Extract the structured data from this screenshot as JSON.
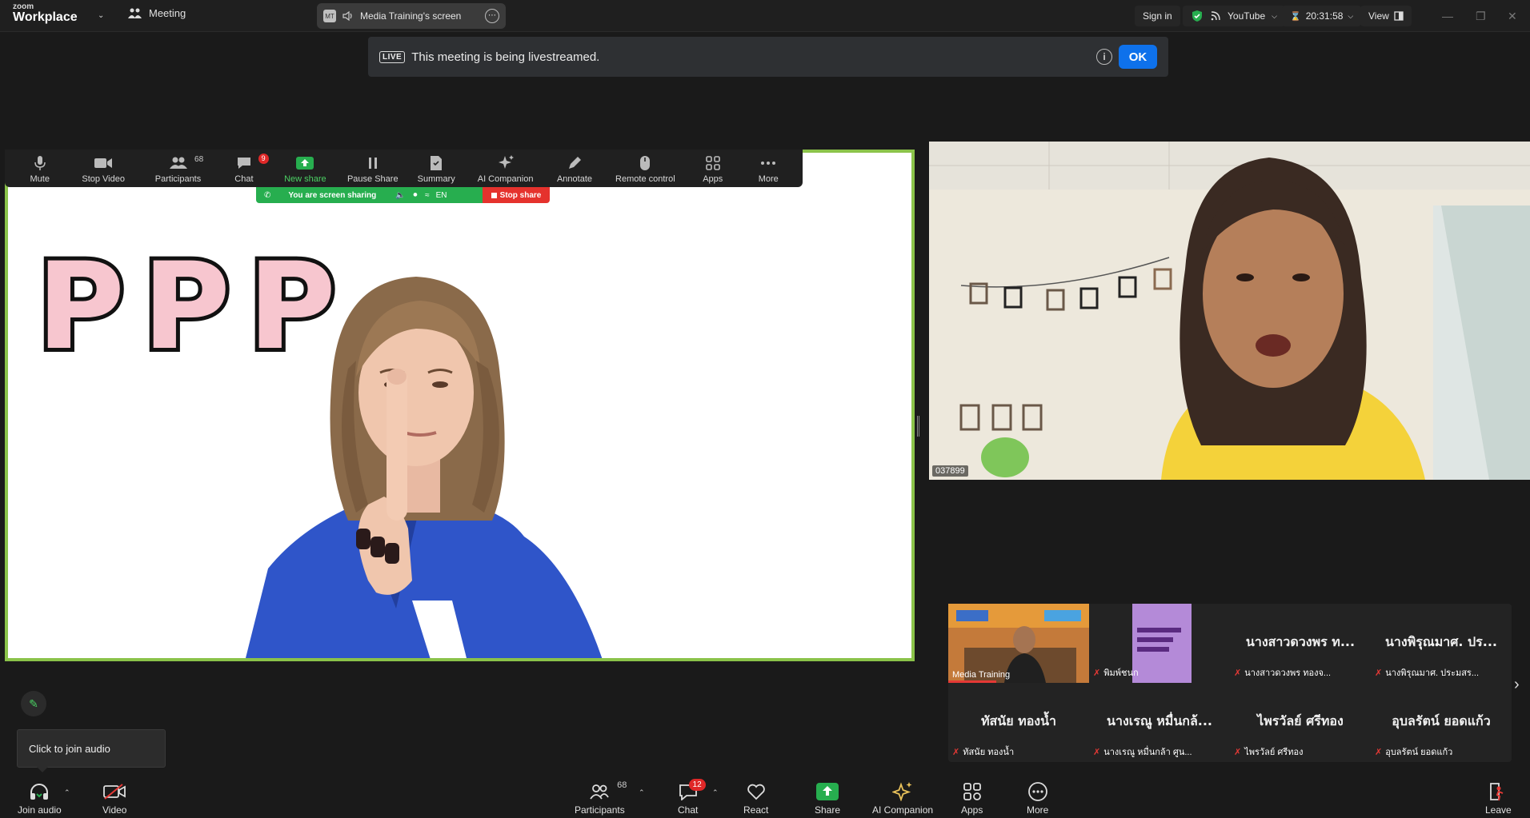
{
  "topbar": {
    "logo_small": "zoom",
    "logo_big": "Workplace",
    "meeting_label": "Meeting",
    "share_tab_label": "Media Training's screen",
    "share_tab_avatar": "MT",
    "sign_in": "Sign in",
    "youtube": "YouTube",
    "timer": "20:31:58",
    "view": "View"
  },
  "banner": {
    "badge": "LIVE",
    "text": "This meeting is being livestreamed.",
    "ok": "OK"
  },
  "share_toolbar": {
    "items": [
      {
        "label": "Mute",
        "icon": "mic-icon"
      },
      {
        "label": "Stop Video",
        "icon": "video-icon"
      },
      {
        "label": "Participants",
        "icon": "participants-icon",
        "count": "68"
      },
      {
        "label": "Chat",
        "icon": "chat-icon",
        "badge": "9"
      },
      {
        "label": "New share",
        "icon": "share-icon"
      },
      {
        "label": "Pause Share",
        "icon": "pause-icon"
      },
      {
        "label": "Summary",
        "icon": "summary-icon"
      },
      {
        "label": "AI Companion",
        "icon": "sparkle-icon"
      },
      {
        "label": "Annotate",
        "icon": "pen-icon"
      },
      {
        "label": "Remote control",
        "icon": "mouse-icon"
      },
      {
        "label": "Apps",
        "icon": "apps-icon"
      },
      {
        "label": "More",
        "icon": "more-icon"
      }
    ],
    "sharing_text": "You are screen sharing",
    "lang": "EN",
    "stop_share": "Stop share"
  },
  "shared_content": {
    "letters": [
      "P",
      "P",
      "P"
    ]
  },
  "camera": {
    "label": "037899"
  },
  "gallery": {
    "tiles": [
      {
        "name": "Media Training",
        "big": "",
        "kind": "video",
        "muted": false
      },
      {
        "name": "พิมพ์ชนก",
        "big": "",
        "kind": "poster",
        "muted": true
      },
      {
        "name": "นางสาวดวงพร ทองจ...",
        "big": "นางสาวดวงพร ท...",
        "kind": "name",
        "muted": true
      },
      {
        "name": "นางพิรุณมาศ. ประมสร...",
        "big": "นางพิรุณมาศ. ปร...",
        "kind": "name",
        "muted": true
      },
      {
        "name": "ทัสนัย ทองน้ำ",
        "big": "ทัสนัย ทองน้ำ",
        "kind": "name",
        "muted": true
      },
      {
        "name": "นางเรณู หมื่นกล้า ศูน...",
        "big": "นางเรณู หมื่นกล้...",
        "kind": "name",
        "muted": true
      },
      {
        "name": "ไพรวัลย์ ศรีทอง",
        "big": "ไพรวัลย์ ศรีทอง",
        "kind": "name",
        "muted": true
      },
      {
        "name": "อุบลรัตน์ ยอดแก้ว",
        "big": "อุบลรัตน์ ยอดแก้ว",
        "kind": "name",
        "muted": true
      }
    ]
  },
  "tooltip": {
    "text": "Click to join audio"
  },
  "bottombar": {
    "join_audio": "Join audio",
    "video": "Video",
    "participants": "Participants",
    "participants_count": "68",
    "chat": "Chat",
    "chat_badge": "12",
    "react": "React",
    "share": "Share",
    "ai_companion": "AI Companion",
    "apps": "Apps",
    "more": "More",
    "leave": "Leave"
  },
  "colors": {
    "accent_blue": "#0e71eb",
    "share_green": "#27ae4f",
    "stop_red": "#e5322d",
    "stage_border": "#8bc34a"
  }
}
